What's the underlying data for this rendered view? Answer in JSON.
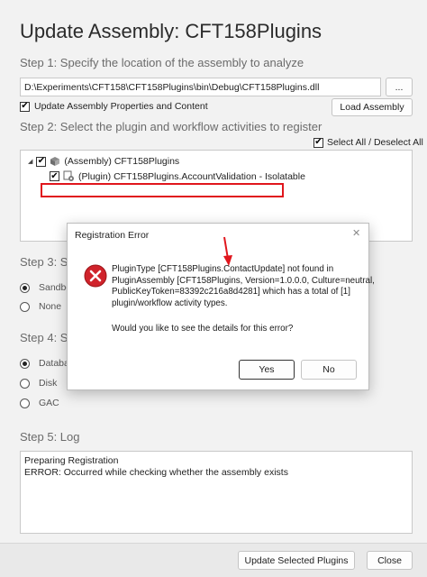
{
  "window": {
    "title": "Update Assembly: CFT158Plugins"
  },
  "step1": {
    "label": "Step 1: Specify the location of the assembly to analyze",
    "path_value": "D:\\Experiments\\CFT158\\CFT158Plugins\\bin\\Debug\\CFT158Plugins.dll",
    "browse_label": "...",
    "update_props_label": "Update Assembly Properties and Content",
    "load_label": "Load Assembly"
  },
  "step2": {
    "label": "Step 2: Select the plugin and workflow activities to register",
    "select_all_label": "Select All / Deselect All",
    "tree": {
      "assembly_label": "(Assembly) CFT158Plugins",
      "plugin_label": "(Plugin) CFT158Plugins.AccountValidation - Isolatable"
    }
  },
  "step3": {
    "label": "Step 3: Sp",
    "options": [
      "Sandbo",
      "None"
    ]
  },
  "step4": {
    "label": "Step 4: Sp",
    "options": [
      "Databa",
      "Disk",
      "GAC"
    ]
  },
  "step5": {
    "label": "Step 5: Log",
    "log_lines": [
      "Preparing Registration",
      "ERROR: Occurred while checking whether the assembly exists"
    ]
  },
  "footer": {
    "update_label": "Update Selected Plugins",
    "close_label": "Close"
  },
  "dialog": {
    "title": "Registration Error",
    "close_glyph": "✕",
    "message_lines": [
      "PluginType [CFT158Plugins.ContactUpdate] not found in",
      "PluginAssembly [CFT158Plugins, Version=1.0.0.0, Culture=neutral,",
      "PublicKeyToken=83392c216a8d4281] which has a total of [1]",
      "plugin/workflow activity types."
    ],
    "question": "Would you like to see the details for this error?",
    "yes_label": "Yes",
    "no_label": "No"
  },
  "colors": {
    "error_icon": "#d0232b",
    "annotation": "#e0161d",
    "check": "#000000"
  }
}
